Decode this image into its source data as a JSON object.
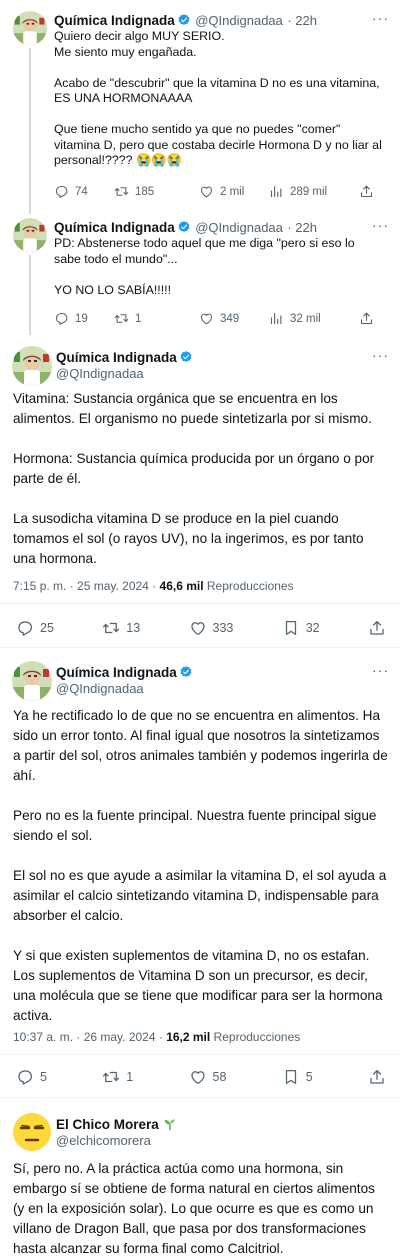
{
  "tweet1": {
    "name": "Química Indignada",
    "handle": "@QIndignadaa",
    "time": "· 22h",
    "text": "Quiero decir algo MUY SERIO.\nMe siento muy engañada.\n\nAcabo de \"descubrir\" que la vitamina D no es una vitamina, ES UNA HORMONAAAA\n\nQue tiene mucho sentido ya que no puedes \"comer\" vitamina D, pero que costaba decirle Hormona D y no liar al personal!???? 😭😭😭",
    "replies": "74",
    "retweets": "185",
    "likes": "2 mil",
    "views": "289 mil"
  },
  "tweet2": {
    "name": "Química Indignada",
    "handle": "@QIndignadaa",
    "time": "· 22h",
    "text": "PD: Abstenerse todo aquel que me diga \"pero si eso lo sabe todo el mundo\"...\n\nYO NO LO SABÍA!!!!!",
    "replies": "19",
    "retweets": "1",
    "likes": "349",
    "views": "32 mil"
  },
  "tweet3": {
    "name": "Química Indignada",
    "handle": "@QIndignadaa",
    "text": "Vitamina: Sustancia orgánica que se encuentra en los alimentos. El organismo no puede sintetizarla por si mismo.\n\nHormona: Sustancia química producida por un órgano o por parte de él.\n\nLa susodicha vitamina D se produce en la piel cuando tomamos el sol (o rayos UV), no la ingerimos, es por tanto una hormona.",
    "timestamp": "7:15 p. m. · 25 may. 2024 · ",
    "views_count": "46,6 mil",
    "views_label": " Reproducciones",
    "replies": "25",
    "retweets": "13",
    "likes": "333",
    "bookmarks": "32"
  },
  "tweet4": {
    "name": "Química Indignada",
    "handle": "@QIndignadaa",
    "text": "Ya he rectificado lo de que no se encuentra en alimentos. Ha sido un error tonto. Al final igual que nosotros la sintetizamos a partir del sol, otros animales también y podemos ingerirla de ahí.\n\nPero no es la fuente principal. Nuestra fuente principal sigue siendo el sol.\n\nEl sol no es que ayude a asimilar la vitamina D, el sol ayuda a asimilar el calcio sintetizando vitamina D, indispensable para absorber el calcio.\n\nY si que existen suplementos de vitamina D, no os estafan. Los suplementos de Vitamina D son un precursor, es decir, una molécula que se tiene que modificar para ser la hormona activa.",
    "timestamp": "10:37 a. m. · 26 may. 2024 · ",
    "views_count": "16,2 mil",
    "views_label": " Reproducciones",
    "replies": "5",
    "retweets": "1",
    "likes": "58",
    "bookmarks": "5"
  },
  "tweet5": {
    "name": "El Chico Morera",
    "handle": "@elchicomorera",
    "text": "Sí, pero no. A la práctica actúa como una hormona, sin embargo sí se obtiene de forma natural en ciertos alimentos (y en la exposición solar). Lo que ocurre es que es como un villano de Dragon Ball, que pasa por dos transformaciones hasta alcanzar su forma final como Calcitriol."
  },
  "more_label": "···",
  "colors": {
    "verified": "#1d9bf0",
    "muted": "#536471",
    "line": "#cfd9de"
  }
}
